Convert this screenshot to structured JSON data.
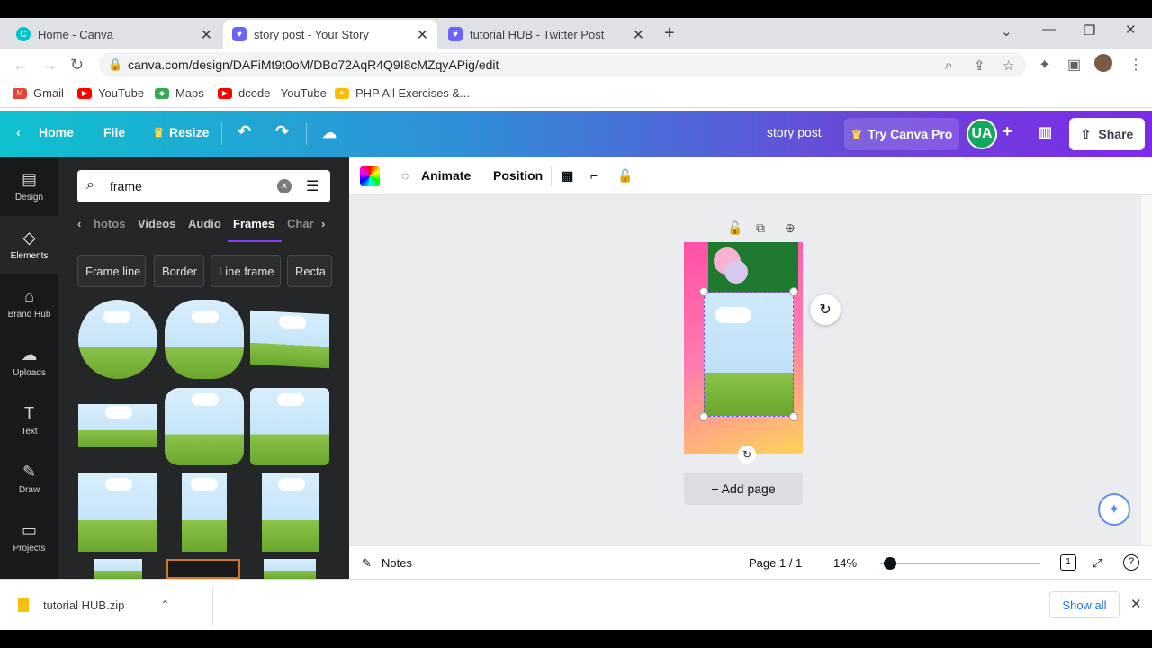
{
  "browser": {
    "tabs": [
      {
        "title": "Home - Canva",
        "icon": "canva-icon",
        "active": false
      },
      {
        "title": "story post - Your Story",
        "icon": "your-story-icon",
        "active": true
      },
      {
        "title": "tutorial HUB - Twitter Post",
        "icon": "your-story-icon",
        "active": false
      }
    ],
    "new_tab": "+",
    "url": "canva.com/design/DAFiMt9t0oM/DBo72AqR4Q9I8cMZqyAPig/edit",
    "bookmarks": [
      {
        "label": "Gmail",
        "icon": "gmail-icon",
        "color": "#ea4335"
      },
      {
        "label": "YouTube",
        "icon": "youtube-icon",
        "color": "#ff0000"
      },
      {
        "label": "Maps",
        "icon": "maps-icon",
        "color": "#34a853"
      },
      {
        "label": "dcode - YouTube",
        "icon": "youtube-icon",
        "color": "#ff0000"
      },
      {
        "label": "PHP All Exercises &...",
        "icon": "php-icon",
        "color": "#fbbc04"
      }
    ]
  },
  "canva": {
    "header": {
      "home": "Home",
      "file": "File",
      "resize": "Resize",
      "design_title": "story post",
      "try_pro": "Try Canva Pro",
      "avatar": "UA",
      "share": "Share"
    },
    "rail": [
      {
        "label": "Design",
        "icon": "design-icon"
      },
      {
        "label": "Elements",
        "icon": "elements-icon",
        "active": true
      },
      {
        "label": "Brand Hub",
        "icon": "brand-hub-icon"
      },
      {
        "label": "Uploads",
        "icon": "upload-icon"
      },
      {
        "label": "Text",
        "icon": "text-icon"
      },
      {
        "label": "Draw",
        "icon": "draw-icon"
      },
      {
        "label": "Projects",
        "icon": "folder-icon"
      }
    ],
    "panel": {
      "search_value": "frame",
      "categories": [
        "hotos",
        "Videos",
        "Audio",
        "Frames",
        "Char"
      ],
      "active_category": "Frames",
      "chips": [
        "Frame line",
        "Border",
        "Line frame",
        "Recta"
      ]
    },
    "toolbar": {
      "animate": "Animate",
      "position": "Position"
    },
    "canvas": {
      "add_page": "+ Add page"
    },
    "footer": {
      "notes": "Notes",
      "page": "Page 1 / 1",
      "zoom": "14%",
      "zoom_fraction": 0.05,
      "page_count_badge": "1"
    }
  },
  "downloads": {
    "file": "tutorial HUB.zip",
    "show_all": "Show all"
  },
  "colors": {
    "canva_purple": "#8b3dff",
    "avatar_green": "#13a85b",
    "panel_bg": "#252627",
    "rail_bg": "#18191b"
  }
}
